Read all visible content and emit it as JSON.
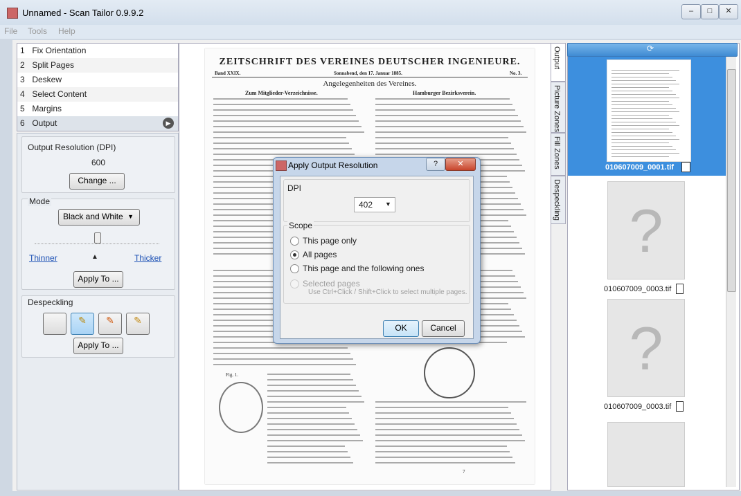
{
  "window": {
    "title": "Unnamed - Scan Tailor 0.9.9.2",
    "min": "–",
    "max": "□",
    "close": "✕"
  },
  "menu": {
    "file": "File",
    "tools": "Tools",
    "help": "Help"
  },
  "stages": [
    {
      "num": "1",
      "label": "Fix Orientation"
    },
    {
      "num": "2",
      "label": "Split Pages"
    },
    {
      "num": "3",
      "label": "Deskew"
    },
    {
      "num": "4",
      "label": "Select Content"
    },
    {
      "num": "5",
      "label": "Margins"
    },
    {
      "num": "6",
      "label": "Output"
    }
  ],
  "play_glyph": "▶",
  "resolution": {
    "title": "Output Resolution (DPI)",
    "value": "600",
    "change": "Change ..."
  },
  "mode": {
    "title": "Mode",
    "selected": "Black and White",
    "thinner": "Thinner",
    "thicker": "Thicker",
    "threshold_level": 0.5,
    "apply": "Apply To ..."
  },
  "despeckling": {
    "title": "Despeckling",
    "apply": "Apply To ..."
  },
  "doc": {
    "journal": "ZEITSCHRIFT DES VEREINES DEUTSCHER INGENIEURE.",
    "band": "Band XXIX.",
    "date": "Sonnabend, den 17. Januar 1885.",
    "no": "No. 3.",
    "section": "Angelegenheiten des Vereines.",
    "col1_head": "Zum Mitglieder-Verzeichnisse.",
    "col2_head": "Hamburger Bezirksverein.",
    "fig": "Fig. 1.",
    "pagenum": "7"
  },
  "side_tabs": [
    "Output",
    "Picture Zones",
    "Fill Zones",
    "Despeckling"
  ],
  "thumbs": [
    {
      "file": "010607009_0001.tif"
    },
    {
      "file": "010607009_0003.tif"
    },
    {
      "file": "010607009_0003.tif"
    }
  ],
  "dialog": {
    "title": "Apply Output Resolution",
    "help": "?",
    "close": "✕",
    "dpi_group": "DPI",
    "dpi_value": "402",
    "scope_group": "Scope",
    "options": [
      "This page only",
      "All pages",
      "This page and the following ones",
      "Selected pages"
    ],
    "selected_hint": "Use Ctrl+Click / Shift+Click to select multiple pages.",
    "ok": "OK",
    "cancel": "Cancel"
  }
}
